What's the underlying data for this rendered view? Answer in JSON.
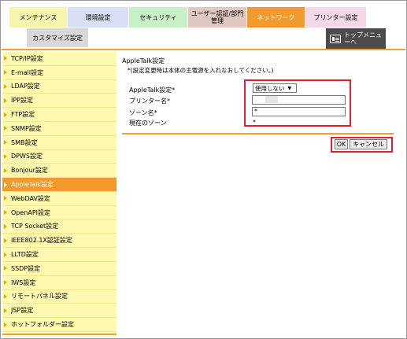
{
  "tabs": [
    {
      "label": "メンテナンス",
      "bg": "#f5f5b0"
    },
    {
      "label": "環境設定",
      "bg": "#d9e0f5"
    },
    {
      "label": "セキュリティ",
      "bg": "#c8f0c8"
    },
    {
      "label": "ユーザー認証/部門管理",
      "bg": "#e0c8c0"
    },
    {
      "label": "ネットワーク",
      "bg": "#f19b2c"
    },
    {
      "label": "プリンター設定",
      "bg": "#f5d8e8"
    }
  ],
  "subtab": "カスタマイズ設定",
  "topmenu": "トップメニューへ",
  "sidebar": [
    "TCP/IP設定",
    "E-mail設定",
    "LDAP設定",
    "IPP設定",
    "FTP設定",
    "SNMP設定",
    "SMB設定",
    "DPWS設定",
    "Bonjour設定",
    "AppleTalk設定",
    "WebDAV設定",
    "OpenAPI設定",
    "TCP Socket設定",
    "IEEE802.1X認証設定",
    "LLTD設定",
    "SSDP設定",
    "IWS設定",
    "リモートパネル設定",
    "JSP設定",
    "ホットフォルダー設定"
  ],
  "active_item": "AppleTalk設定",
  "page": {
    "title": "AppleTalk設定",
    "note": "*(設定変更時は本体の主電源を入れなおしてください。)",
    "labels": {
      "appletalk": "AppleTalk設定*",
      "printer_name": "プリンター名*",
      "zone_name": "ゾーン名*",
      "current_zone": "現在のゾーン"
    },
    "appletalk_value": "使用しない",
    "printer_name_value": "",
    "zone_name_value": "*",
    "current_zone_value": "*"
  },
  "buttons": {
    "ok": "OK",
    "cancel": "キャンセル"
  }
}
